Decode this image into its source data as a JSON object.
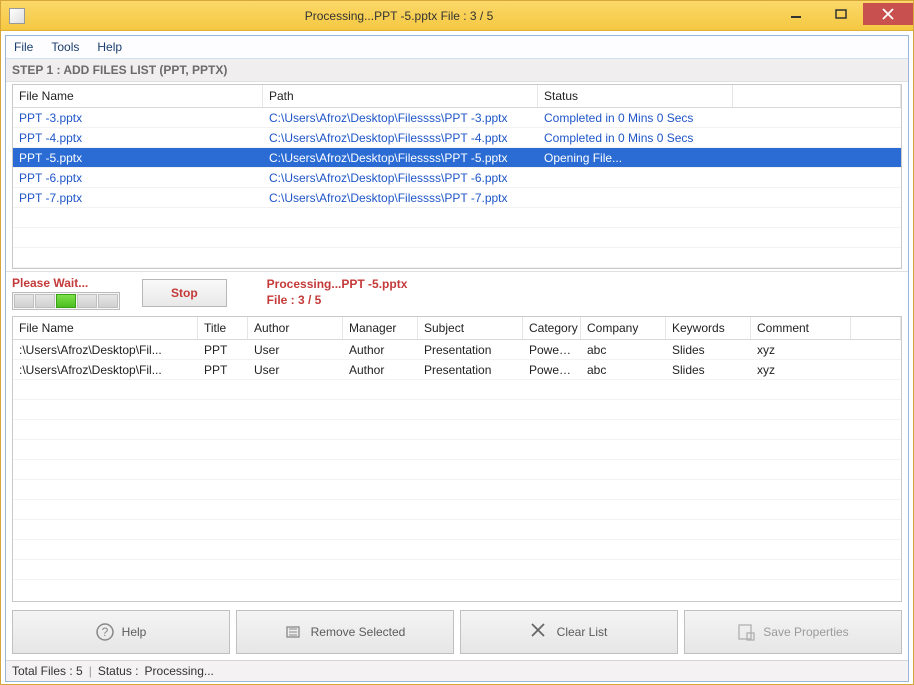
{
  "window": {
    "title": "Processing...PPT -5.pptx File : 3 / 5"
  },
  "menu": {
    "file": "File",
    "tools": "Tools",
    "help": "Help"
  },
  "step1": {
    "header": "STEP 1 : ADD FILES LIST (PPT, PPTX)",
    "columns": {
      "filename": "File Name",
      "path": "Path",
      "status": "Status"
    },
    "rows": [
      {
        "filename": "PPT -3.pptx",
        "path": "C:\\Users\\Afroz\\Desktop\\Filessss\\PPT -3.pptx",
        "status": "Completed in 0 Mins 0 Secs",
        "selected": false
      },
      {
        "filename": "PPT -4.pptx",
        "path": "C:\\Users\\Afroz\\Desktop\\Filessss\\PPT -4.pptx",
        "status": "Completed in 0 Mins 0 Secs",
        "selected": false
      },
      {
        "filename": "PPT -5.pptx",
        "path": "C:\\Users\\Afroz\\Desktop\\Filessss\\PPT -5.pptx",
        "status": "Opening File...",
        "selected": true
      },
      {
        "filename": "PPT -6.pptx",
        "path": "C:\\Users\\Afroz\\Desktop\\Filessss\\PPT -6.pptx",
        "status": "",
        "selected": false
      },
      {
        "filename": "PPT -7.pptx",
        "path": "C:\\Users\\Afroz\\Desktop\\Filessss\\PPT -7.pptx",
        "status": "",
        "selected": false
      }
    ]
  },
  "progress": {
    "please_wait": "Please Wait...",
    "stop": "Stop",
    "line1": "Processing...PPT -5.pptx",
    "line2": "File : 3 / 5"
  },
  "grid2": {
    "columns": {
      "filename": "File Name",
      "title": "Title",
      "author": "Author",
      "manager": "Manager",
      "subject": "Subject",
      "category": "Category",
      "company": "Company",
      "keywords": "Keywords",
      "comment": "Comment"
    },
    "rows": [
      {
        "filename": ":\\Users\\Afroz\\Desktop\\Fil...",
        "title": "PPT",
        "author": "User",
        "manager": "Author",
        "subject": "Presentation",
        "category": "Powerp...",
        "company": "abc",
        "keywords": "Slides",
        "comment": "xyz"
      },
      {
        "filename": ":\\Users\\Afroz\\Desktop\\Fil...",
        "title": "PPT",
        "author": "User",
        "manager": "Author",
        "subject": "Presentation",
        "category": "Powerp...",
        "company": "abc",
        "keywords": "Slides",
        "comment": "xyz"
      }
    ]
  },
  "buttons": {
    "help": "Help",
    "remove": "Remove Selected",
    "clear": "Clear List",
    "save": "Save Properties"
  },
  "statusbar": {
    "total": "Total Files : 5",
    "status_label": "Status :",
    "status_value": "Processing..."
  }
}
